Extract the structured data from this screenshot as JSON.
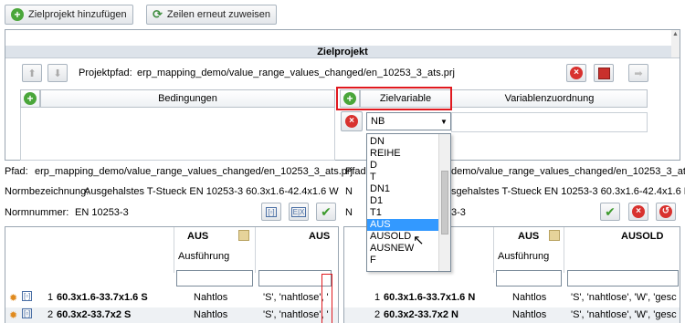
{
  "toolbar": {
    "add_target_project": "Zielprojekt hinzufügen",
    "reassign_rows": "Zeilen erneut zuweisen"
  },
  "target_project": {
    "title": "Zielprojekt",
    "path_label": "Projektpfad:",
    "path_value": "erp_mapping_demo/value_range_values_changed/en_10253_3_ats.prj",
    "conditions_header": "Bedingungen",
    "target_variable_header": "Zielvariable",
    "variable_assignment_header": "Variablenzuordnung",
    "selected_variable": "NB",
    "dropdown_options": [
      "DN",
      "REIHE",
      "D",
      "T",
      "DN1",
      "D1",
      "T1",
      "AUS",
      "AUSOLD",
      "AUSNEW",
      "F"
    ],
    "highlighted_option": "AUS"
  },
  "left_info": {
    "path_label": "Pfad:",
    "path_value": "erp_mapping_demo/value_range_values_changed/en_10253_3_ats.prj",
    "norm_name_label": "Normbezeichnung:",
    "norm_name_value": "Ausgehalstes T-Stueck EN 10253-3 60.3x1.6-42.4x1.6 W",
    "norm_number_label": "Normnummer:",
    "norm_number_value": "EN 10253-3"
  },
  "right_info": {
    "path_tail": "demo/value_range_values_changed/en_10253_3_ats.prj",
    "norm_name_prefix": "N",
    "norm_name_tail": "sgehalstes T-Stueck EN 10253-3 60.3x1.6-42.4x1.6 N",
    "norm_number_prefix": "N",
    "norm_number_tail": "3-3"
  },
  "left_table": {
    "col_aus": "AUS",
    "col_aus_sub": "Ausführung",
    "col_aus2": "AUS",
    "rows": [
      {
        "num": "1",
        "name": "60.3x1.6-33.7x1.6 S",
        "aus": "Nahtlos",
        "vals": "'S', 'nahtlose', '"
      },
      {
        "num": "2",
        "name": "60.3x2-33.7x2 S",
        "aus": "Nahtlos",
        "vals": "'S', 'nahtlose', '"
      }
    ]
  },
  "right_table": {
    "col_aus": "AUS",
    "col_aus_sub": "Ausführung",
    "col_ausold": "AUSOLD",
    "rows": [
      {
        "num": "1",
        "name": "60.3x1.6-33.7x1.6 N",
        "aus": "Nahtlos",
        "vals": "'S', 'nahtlose', 'W', 'gesc"
      },
      {
        "num": "2",
        "name": "60.3x2-33.7x2 N",
        "aus": "Nahtlos",
        "vals": "'S', 'nahtlose', 'W', 'gesc"
      }
    ]
  },
  "colors": {
    "highlight_border": "#e0191f",
    "selection_blue": "#3399ff",
    "header_bar": "#dde3ea"
  }
}
